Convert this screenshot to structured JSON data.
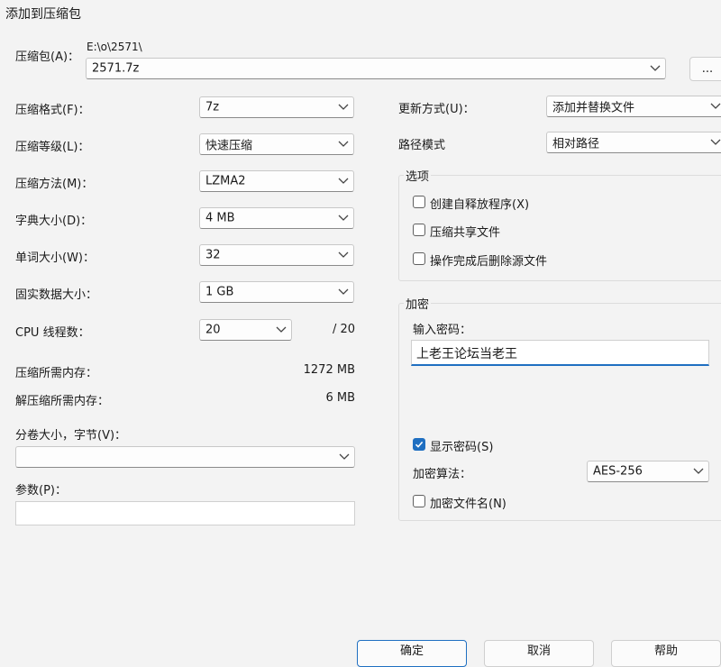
{
  "window": {
    "title": "添加到压缩包"
  },
  "archive": {
    "label": "压缩包(A)：",
    "path": "E:\\o\\2571\\",
    "filename": "2571.7z",
    "browse_label": "..."
  },
  "left": {
    "format": {
      "label": "压缩格式(F)：",
      "value": "7z"
    },
    "level": {
      "label": "压缩等级(L)：",
      "value": "快速压缩"
    },
    "method": {
      "label": "压缩方法(M)：",
      "value": "LZMA2"
    },
    "dict": {
      "label": "字典大小(D)：",
      "value": "4 MB"
    },
    "word": {
      "label": "单词大小(W)：",
      "value": "32"
    },
    "solid": {
      "label": "固实数据大小：",
      "value": "1 GB"
    },
    "threads": {
      "label": "CPU 线程数：",
      "value": "20",
      "max": "/ 20"
    },
    "mem_compress": {
      "label": "压缩所需内存：",
      "value": "1272 MB"
    },
    "mem_decompress": {
      "label": "解压缩所需内存：",
      "value": "6 MB"
    },
    "volume": {
      "label": "分卷大小，字节(V)：",
      "value": ""
    },
    "params": {
      "label": "参数(P)：",
      "value": ""
    }
  },
  "right": {
    "update": {
      "label": "更新方式(U)：",
      "value": "添加并替换文件"
    },
    "path_mode": {
      "label": "路径模式",
      "value": "相对路径"
    },
    "options": {
      "legend": "选项",
      "sfx": {
        "label": "创建自释放程序(X)",
        "checked": false
      },
      "shared": {
        "label": "压缩共享文件",
        "checked": false
      },
      "delete": {
        "label": "操作完成后删除源文件",
        "checked": false
      }
    },
    "encryption": {
      "legend": "加密",
      "password_label": "输入密码：",
      "password_value": "上老王论坛当老王",
      "show_password": {
        "label": "显示密码(S)",
        "checked": true
      },
      "method_label": "加密算法：",
      "method_value": "AES-256",
      "encrypt_names": {
        "label": "加密文件名(N)",
        "checked": false
      }
    }
  },
  "buttons": {
    "ok": "确定",
    "cancel": "取消",
    "help": "帮助"
  },
  "colors": {
    "accent": "#1f6fc1",
    "background": "#f3f3f3"
  }
}
